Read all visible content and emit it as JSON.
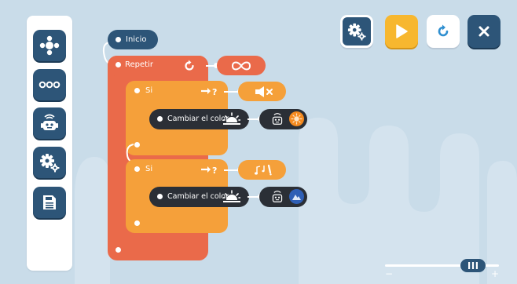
{
  "sidebar": {
    "buttons": [
      {
        "icon": "dpad-icon"
      },
      {
        "icon": "more-dots-icon"
      },
      {
        "icon": "robot-icon"
      },
      {
        "icon": "settings-gears-icon"
      },
      {
        "icon": "save-disk-icon"
      }
    ]
  },
  "toolbar": {
    "settings_icon": "settings-gears-icon",
    "play_icon": "play-icon",
    "reset_icon": "refresh-icon",
    "close_icon": "close-icon",
    "colors": {
      "settings": "#2d5578",
      "play": "#f7b72f",
      "reset": "#ffffff",
      "close": "#2d5578"
    }
  },
  "program": {
    "start_label": "Inicio",
    "repeat_label": "Repetir",
    "repeat_param_icon": "infinity-icon",
    "repeat_icon": "loop-arrow-icon",
    "if1": {
      "label": "Si",
      "condition_icon": "arrow-question-icon",
      "sensor_icon": "speaker-mute-icon",
      "action_label": "Cambiar el color",
      "action_icon": "sunrise-icon",
      "color_icon": "orange-color-icon",
      "color": "#f58a1f"
    },
    "if2": {
      "label": "Si",
      "condition_icon": "arrow-question-icon",
      "sensor_icon": "music-notes-icon",
      "action_label": "Cambiar el color",
      "action_icon": "sunrise-icon",
      "color_icon": "blue-color-icon",
      "color": "#2f5fb5"
    }
  },
  "zoom": {
    "level": 0.85,
    "minus_label": "−",
    "plus_label": "+"
  }
}
